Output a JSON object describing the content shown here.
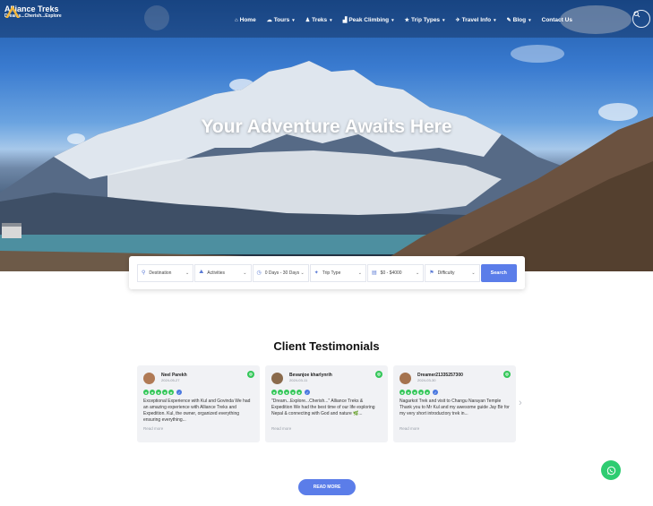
{
  "brand": {
    "name": "Alliance Treks",
    "tagline": "Dreams...Cherish...Explore"
  },
  "nav": {
    "items": [
      {
        "label": "Home",
        "icon": "home-icon",
        "glyph": "⌂",
        "dropdown": false
      },
      {
        "label": "Tours",
        "icon": "cloud-icon",
        "glyph": "☁",
        "dropdown": true
      },
      {
        "label": "Treks",
        "icon": "hiker-icon",
        "glyph": "♟",
        "dropdown": true
      },
      {
        "label": "Peak Climbing",
        "icon": "chart-icon",
        "glyph": "▟",
        "dropdown": true
      },
      {
        "label": "Trip Types",
        "icon": "star-icon",
        "glyph": "★",
        "dropdown": true
      },
      {
        "label": "Travel Info",
        "icon": "plane-icon",
        "glyph": "✈",
        "dropdown": true
      },
      {
        "label": "Blog",
        "icon": "pen-icon",
        "glyph": "✎",
        "dropdown": true
      },
      {
        "label": "Contact Us",
        "icon": "",
        "glyph": "",
        "dropdown": false
      }
    ],
    "search_icon": "search-icon",
    "caret": "▾"
  },
  "hero": {
    "title": "Your Adventure Awaits Here"
  },
  "search": {
    "destination": "Destination",
    "activities": "Activities",
    "duration": "0 Days - 30 Days",
    "trip_type": "Trip Type",
    "price": "$0 - $4000",
    "difficulty": "Difficulty",
    "button": "Search",
    "caret": "⌄"
  },
  "testimonials": {
    "title": "Client Testimonials",
    "read_more_label": "Read more",
    "cards": [
      {
        "name": "Neel Parekh",
        "date": "2024-05-27",
        "text": "Exceptional Experience with Kul and Govinda We had an amazing experience with Alliance Treks and Expedition. Kul, the owner, organized everything ensuring everything...",
        "avatar_color": "#b07a55"
      },
      {
        "name": "Bevanjoe Kharlyngdoh",
        "name_display": "Bevanjoe kharlynrih",
        "date": "2024-03-11",
        "text": "\"Dream...Explore...Cherish...\" Alliance Treks & Expedition We had the best time of our life exploring Nepal & connecting with God and nature 🌿...",
        "avatar_color": "#8a6a4c"
      },
      {
        "name": "Dreamer21335257300",
        "date": "2024-03-30",
        "text": "Nagarkot Trek and visit to Changu Narayan Temple Thank you to Mr Kul and my awesome guide Jay Bir for my very short introductory trek in...",
        "avatar_color": "#a5734f"
      }
    ],
    "star_glyph": "★",
    "check_glyph": "✓",
    "ta_glyph": "◎",
    "next_glyph": "›"
  },
  "cta": {
    "read_more": "READ MORE"
  },
  "colors": {
    "accent": "#5b7de9",
    "trip_green": "#34c759",
    "whatsapp": "#2ecc71"
  }
}
